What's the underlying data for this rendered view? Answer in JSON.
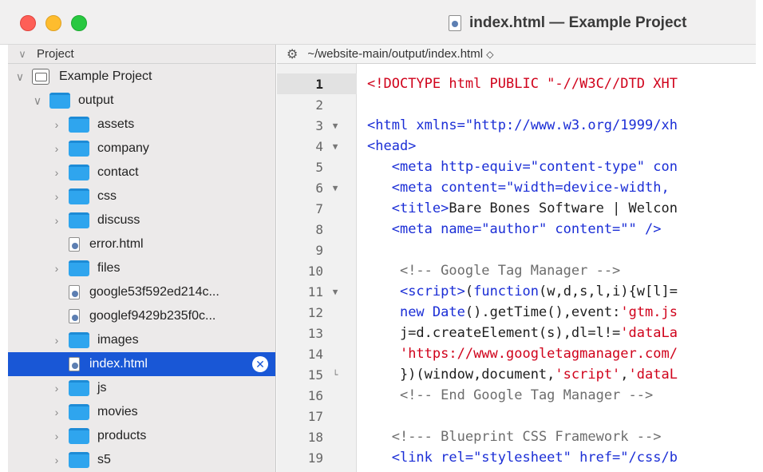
{
  "window": {
    "title": "index.html — Example Project",
    "colors": {
      "close": "#fe5f57",
      "minimize": "#febc2e",
      "maximize": "#28c840"
    }
  },
  "sidebar": {
    "header": "Project",
    "project_name": "Example Project",
    "folder_root": "output",
    "items": [
      {
        "label": "assets",
        "type": "folder"
      },
      {
        "label": "company",
        "type": "folder"
      },
      {
        "label": "contact",
        "type": "folder"
      },
      {
        "label": "css",
        "type": "folder"
      },
      {
        "label": "discuss",
        "type": "folder"
      },
      {
        "label": "error.html",
        "type": "file"
      },
      {
        "label": "files",
        "type": "folder"
      },
      {
        "label": "google53f592ed214c...",
        "type": "file"
      },
      {
        "label": "googlef9429b235f0c...",
        "type": "file"
      },
      {
        "label": "images",
        "type": "folder"
      },
      {
        "label": "index.html",
        "type": "file",
        "selected": true
      },
      {
        "label": "js",
        "type": "folder"
      },
      {
        "label": "movies",
        "type": "folder"
      },
      {
        "label": "products",
        "type": "folder"
      },
      {
        "label": "s5",
        "type": "folder"
      }
    ],
    "selection_color": "#1957d6"
  },
  "editor": {
    "path": "~/website-main/output/index.html",
    "path_suffix": "◇",
    "lines": [
      {
        "n": "1",
        "fold": "",
        "current": true,
        "parts": [
          [
            "c-red",
            "<!DOCTYPE html PUBLIC \"-//W3C//DTD XHT"
          ]
        ]
      },
      {
        "n": "2",
        "fold": "",
        "parts": []
      },
      {
        "n": "3",
        "fold": "▼",
        "parts": [
          [
            "c-blue",
            "<html xmlns=\"http://www.w3.org/1999/xh"
          ]
        ]
      },
      {
        "n": "4",
        "fold": "▼",
        "parts": [
          [
            "c-blue",
            "<head>"
          ]
        ]
      },
      {
        "n": "5",
        "fold": "",
        "parts": [
          [
            "c-dark",
            "   "
          ],
          [
            "c-blue",
            "<meta http-equiv=\"content-type\" con"
          ]
        ]
      },
      {
        "n": "6",
        "fold": "▼",
        "parts": [
          [
            "c-dark",
            "   "
          ],
          [
            "c-blue",
            "<meta content=\"width=device-width, "
          ]
        ]
      },
      {
        "n": "7",
        "fold": "",
        "parts": [
          [
            "c-dark",
            "   "
          ],
          [
            "c-blue",
            "<title>"
          ],
          [
            "c-dark",
            "Bare Bones Software | Welcon"
          ]
        ]
      },
      {
        "n": "8",
        "fold": "",
        "parts": [
          [
            "c-dark",
            "   "
          ],
          [
            "c-blue",
            "<meta name=\"author\" content=\"\" />"
          ]
        ]
      },
      {
        "n": "9",
        "fold": "",
        "parts": []
      },
      {
        "n": "10",
        "fold": "",
        "parts": [
          [
            "c-dark",
            "    "
          ],
          [
            "c-comment",
            "<!-- Google Tag Manager -->"
          ]
        ]
      },
      {
        "n": "11",
        "fold": "▼",
        "parts": [
          [
            "c-dark",
            "    "
          ],
          [
            "c-blue",
            "<script>"
          ],
          [
            "c-dark",
            "("
          ],
          [
            "c-keyword",
            "function"
          ],
          [
            "c-dark",
            "(w,d,s,l,i){w[l]="
          ]
        ]
      },
      {
        "n": "12",
        "fold": "",
        "parts": [
          [
            "c-dark",
            "    "
          ],
          [
            "c-keyword",
            "new"
          ],
          [
            "c-dark",
            " "
          ],
          [
            "c-keyword",
            "Date"
          ],
          [
            "c-dark",
            "().getTime(),event:"
          ],
          [
            "c-string",
            "'gtm.js"
          ]
        ]
      },
      {
        "n": "13",
        "fold": "",
        "parts": [
          [
            "c-dark",
            "    j=d.createElement(s),dl=l!="
          ],
          [
            "c-string",
            "'dataLa"
          ]
        ]
      },
      {
        "n": "14",
        "fold": "",
        "parts": [
          [
            "c-dark",
            "    "
          ],
          [
            "c-string",
            "'https://www.googletagmanager.com/"
          ]
        ]
      },
      {
        "n": "15",
        "fold": "└",
        "parts": [
          [
            "c-dark",
            "    })(window,document,"
          ],
          [
            "c-string",
            "'script'"
          ],
          [
            "c-dark",
            ","
          ],
          [
            "c-string",
            "'dataL"
          ]
        ]
      },
      {
        "n": "16",
        "fold": "",
        "parts": [
          [
            "c-dark",
            "    "
          ],
          [
            "c-comment",
            "<!-- End Google Tag Manager -->"
          ]
        ]
      },
      {
        "n": "17",
        "fold": "",
        "parts": []
      },
      {
        "n": "18",
        "fold": "",
        "parts": [
          [
            "c-dark",
            "   "
          ],
          [
            "c-comment",
            "<!--- Blueprint CSS Framework -->"
          ]
        ]
      },
      {
        "n": "19",
        "fold": "",
        "parts": [
          [
            "c-dark",
            "   "
          ],
          [
            "c-blue",
            "<link rel=\"stylesheet\" href=\"/css/b"
          ]
        ]
      }
    ]
  }
}
